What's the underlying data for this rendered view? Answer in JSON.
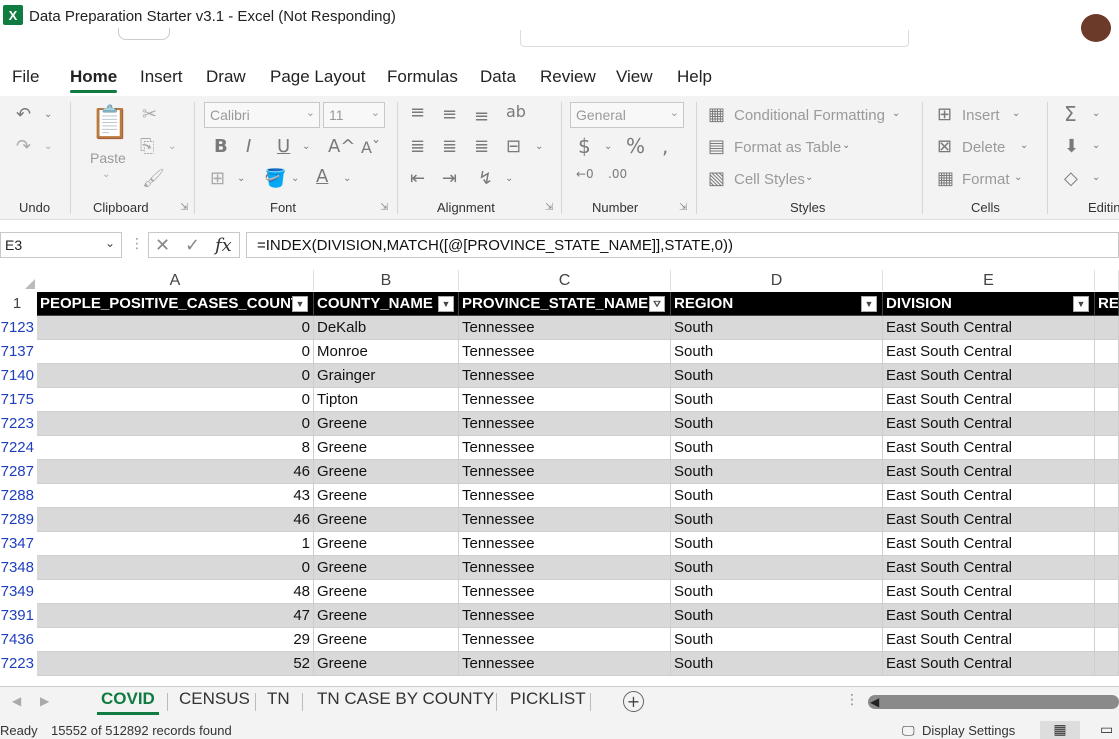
{
  "window": {
    "app_icon": "X",
    "title": "Data Preparation Starter v3.1 - Excel (Not Responding)"
  },
  "menu": [
    "File",
    "Home",
    "Insert",
    "Draw",
    "Page Layout",
    "Formulas",
    "Data",
    "Review",
    "View",
    "Help"
  ],
  "menu_active": "Home",
  "ribbon": {
    "groups": {
      "undo": "Undo",
      "clipboard": "Clipboard",
      "font": "Font",
      "alignment": "Alignment",
      "number": "Number",
      "styles": "Styles",
      "cells": "Cells",
      "editing": "Editing"
    },
    "paste_label": "Paste",
    "font_name": "Calibri",
    "font_size": "11",
    "number_format": "General",
    "conditional_formatting": "Conditional Formatting",
    "format_as_table": "Format as Table",
    "cell_styles": "Cell Styles",
    "insert": "Insert",
    "delete": "Delete",
    "format": "Format"
  },
  "formula_bar": {
    "name_box": "E3",
    "fx": "fx",
    "formula": "=INDEX(DIVISION,MATCH([@[PROVINCE_STATE_NAME]],STATE,0))"
  },
  "grid": {
    "columns": [
      "A",
      "B",
      "C",
      "D",
      "E"
    ],
    "header_row_number": "1",
    "headers": [
      "PEOPLE_POSITIVE_CASES_COUNT",
      "COUNTY_NAME",
      "PROVINCE_STATE_NAME",
      "REGION",
      "DIVISION",
      "REI"
    ],
    "rows": [
      {
        "row": "7123",
        "cases": "0",
        "county": "DeKalb",
        "state": "Tennessee",
        "region": "South",
        "division": "East South Central"
      },
      {
        "row": "7137",
        "cases": "0",
        "county": "Monroe",
        "state": "Tennessee",
        "region": "South",
        "division": "East South Central"
      },
      {
        "row": "7140",
        "cases": "0",
        "county": "Grainger",
        "state": "Tennessee",
        "region": "South",
        "division": "East South Central"
      },
      {
        "row": "7175",
        "cases": "0",
        "county": "Tipton",
        "state": "Tennessee",
        "region": "South",
        "division": "East South Central"
      },
      {
        "row": "7223",
        "cases": "0",
        "county": "Greene",
        "state": "Tennessee",
        "region": "South",
        "division": "East South Central"
      },
      {
        "row": "7224",
        "cases": "8",
        "county": "Greene",
        "state": "Tennessee",
        "region": "South",
        "division": "East South Central"
      },
      {
        "row": "7287",
        "cases": "46",
        "county": "Greene",
        "state": "Tennessee",
        "region": "South",
        "division": "East South Central"
      },
      {
        "row": "7288",
        "cases": "43",
        "county": "Greene",
        "state": "Tennessee",
        "region": "South",
        "division": "East South Central"
      },
      {
        "row": "7289",
        "cases": "46",
        "county": "Greene",
        "state": "Tennessee",
        "region": "South",
        "division": "East South Central"
      },
      {
        "row": "7347",
        "cases": "1",
        "county": "Greene",
        "state": "Tennessee",
        "region": "South",
        "division": "East South Central"
      },
      {
        "row": "7348",
        "cases": "0",
        "county": "Greene",
        "state": "Tennessee",
        "region": "South",
        "division": "East South Central"
      },
      {
        "row": "7349",
        "cases": "48",
        "county": "Greene",
        "state": "Tennessee",
        "region": "South",
        "division": "East South Central"
      },
      {
        "row": "7391",
        "cases": "47",
        "county": "Greene",
        "state": "Tennessee",
        "region": "South",
        "division": "East South Central"
      },
      {
        "row": "7436",
        "cases": "29",
        "county": "Greene",
        "state": "Tennessee",
        "region": "South",
        "division": "East South Central"
      },
      {
        "row": "7223",
        "cases": "52",
        "county": "Greene",
        "state": "Tennessee",
        "region": "South",
        "division": "East South Central"
      }
    ]
  },
  "sheets": [
    "COVID",
    "CENSUS",
    "TN",
    "TN CASE BY COUNTY",
    "PICKLIST"
  ],
  "active_sheet": "COVID",
  "status": {
    "mode": "Ready",
    "records": "15552 of 512892 records found",
    "display_settings": "Display Settings"
  },
  "colors": {
    "accent": "#107c41",
    "header_bg": "#000000",
    "alt_row": "#d9d9d9",
    "row_number": "#1f3fbf"
  },
  "icons": [
    "excel-logo-icon",
    "undo-icon",
    "redo-icon",
    "paste-icon",
    "cut-icon",
    "copy-icon",
    "format-painter-icon",
    "bold-icon",
    "italic-icon",
    "underline-icon",
    "borders-icon",
    "fill-color-icon",
    "font-color-icon",
    "align-icon",
    "wrap-text-icon",
    "merge-icon",
    "currency-icon",
    "percent-icon",
    "comma-icon",
    "sum-icon",
    "fill-icon",
    "clear-icon",
    "filter-icon",
    "add-sheet-icon"
  ]
}
